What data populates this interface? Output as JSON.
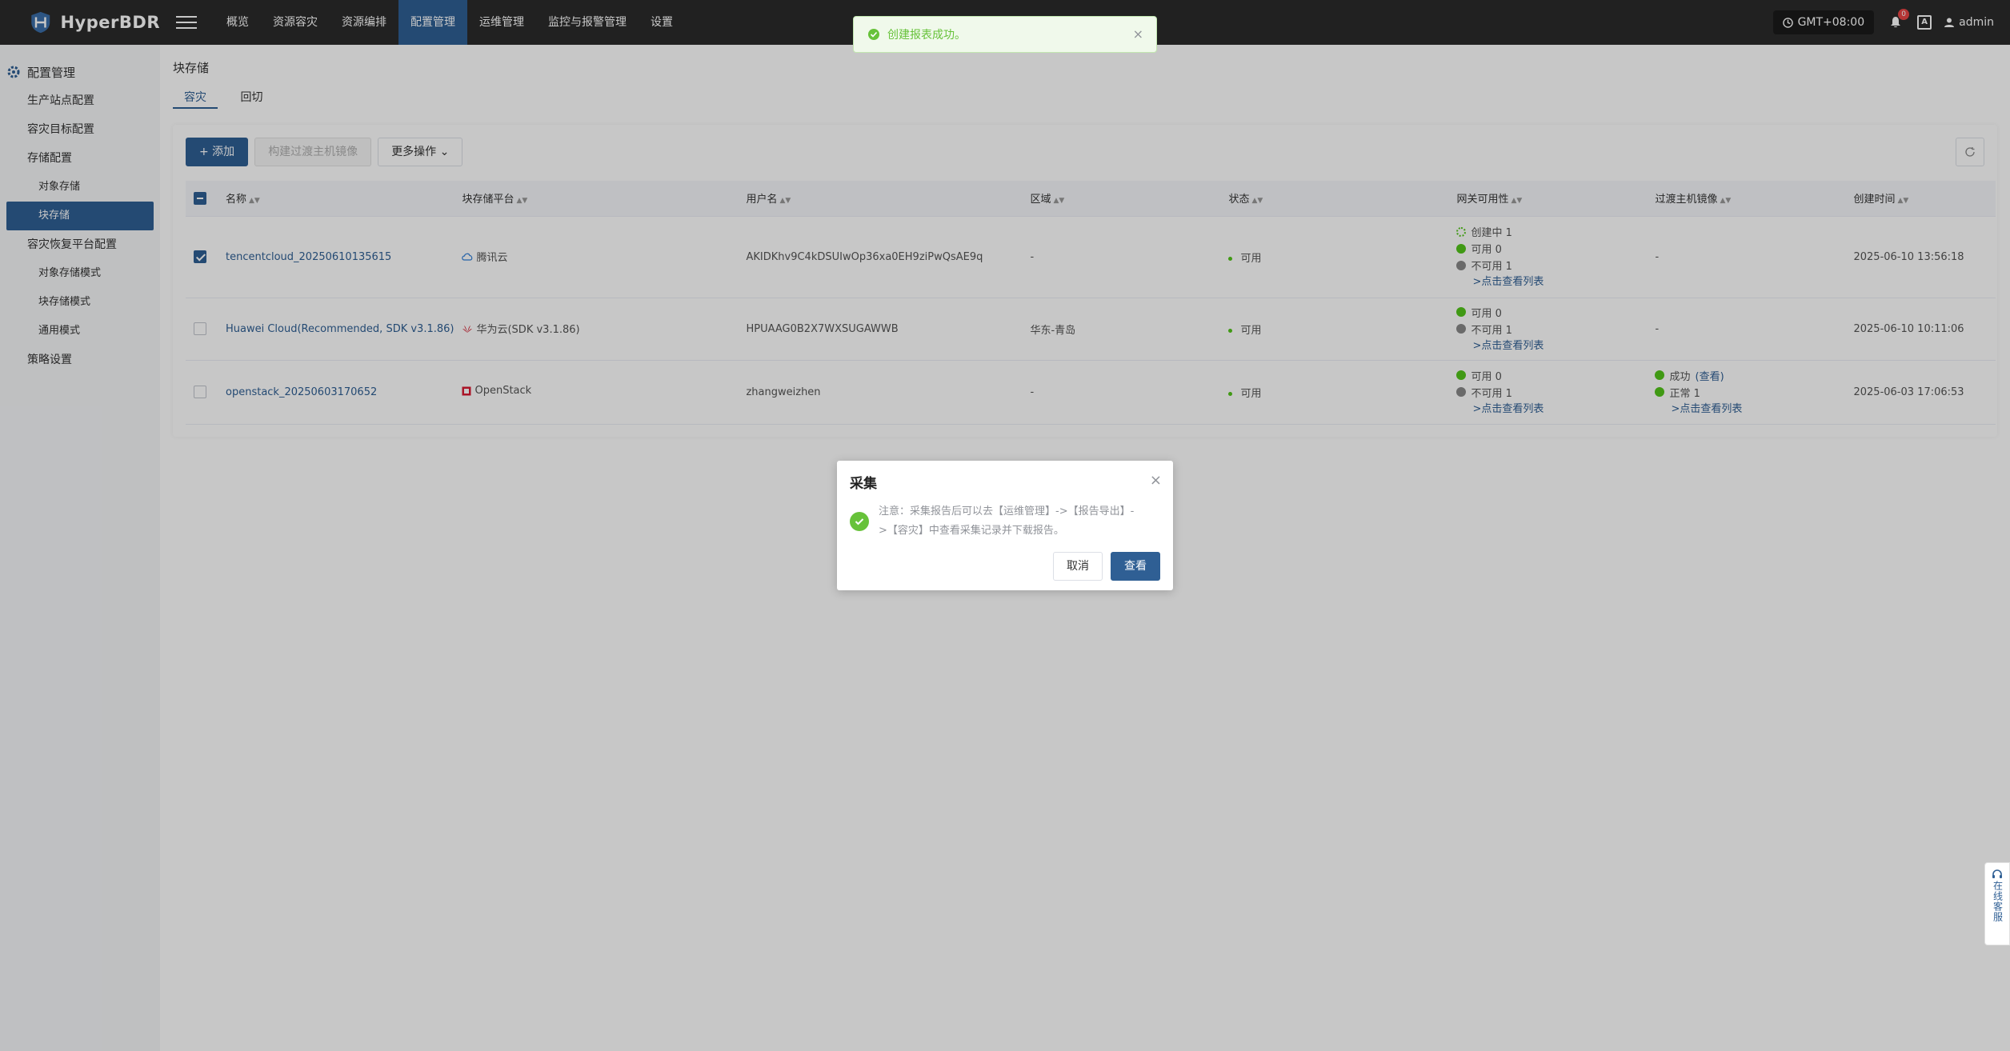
{
  "app": {
    "name": "HyperBDR"
  },
  "nav": {
    "items": [
      {
        "label": "概览"
      },
      {
        "label": "资源容灾"
      },
      {
        "label": "资源编排"
      },
      {
        "label": "配置管理"
      },
      {
        "label": "运维管理"
      },
      {
        "label": "监控与报警管理"
      },
      {
        "label": "设置"
      }
    ],
    "active_index": 3
  },
  "topright": {
    "timezone": "GMT+08:00",
    "bell_badge": "0",
    "lang_icon": "A",
    "user": "admin"
  },
  "sidebar": {
    "title": "配置管理",
    "items": [
      {
        "label": "生产站点配置"
      },
      {
        "label": "容灾目标配置"
      },
      {
        "label": "存储配置"
      },
      {
        "label": "对象存储"
      },
      {
        "label": "块存储"
      },
      {
        "label": "容灾恢复平台配置"
      },
      {
        "label": "对象存储模式"
      },
      {
        "label": "块存储模式"
      },
      {
        "label": "通用模式"
      },
      {
        "label": "策略设置"
      }
    ]
  },
  "page": {
    "title": "块存储",
    "tabs": [
      {
        "label": "容灾"
      },
      {
        "label": "回切"
      }
    ],
    "toolbar": {
      "add": "+ 添加",
      "build": "构建过渡主机镜像",
      "more": "更多操作"
    }
  },
  "table": {
    "headers": [
      "名称",
      "块存储平台",
      "用户名",
      "区域",
      "状态",
      "网关可用性",
      "过渡主机镜像",
      "创建时间"
    ],
    "rows": [
      {
        "name": "tencentcloud_20250610135615",
        "platform": "腾讯云",
        "username": "AKIDKhv9C4kDSUIwOp36xa0EH9ziPwQsAE9q",
        "region": "-",
        "status": "可用",
        "gw": [
          "创建中 1",
          "可用 0",
          "不可用 1"
        ],
        "gw_link": ">点击查看列表",
        "image": "-",
        "created": "2025-06-10 13:56:18"
      },
      {
        "name": "Huawei Cloud(Recommended, SDK v3.1.86)",
        "platform": "华为云(SDK v3.1.86)",
        "username": "HPUAAG0B2X7WXSUGAWWB",
        "region": "华东-青岛",
        "status": "可用",
        "gw": [
          "可用 0",
          "不可用 1"
        ],
        "gw_link": ">点击查看列表",
        "image": "-",
        "created": "2025-06-10 10:11:06"
      },
      {
        "name": "openstack_20250603170652",
        "platform": "OpenStack",
        "username": "zhangweizhen",
        "region": "-",
        "status": "可用",
        "gw": [
          "可用 0",
          "不可用 1"
        ],
        "gw_link": ">点击查看列表",
        "image_lines": [
          "成功",
          "(查看)",
          "正常 1"
        ],
        "image_link": ">点击查看列表",
        "created": "2025-06-03 17:06:53"
      }
    ]
  },
  "toast": {
    "message": "创建报表成功。"
  },
  "dialog": {
    "title": "采集",
    "message": "注意：采集报告后可以去【运维管理】->【报告导出】->【容灾】中查看采集记录并下载报告。",
    "cancel": "取消",
    "confirm": "查看"
  },
  "service": {
    "label": "在线客服"
  },
  "colors": {
    "primary": "#2f5f94",
    "success": "#52c41a",
    "topbar": "#2b2b2b"
  }
}
